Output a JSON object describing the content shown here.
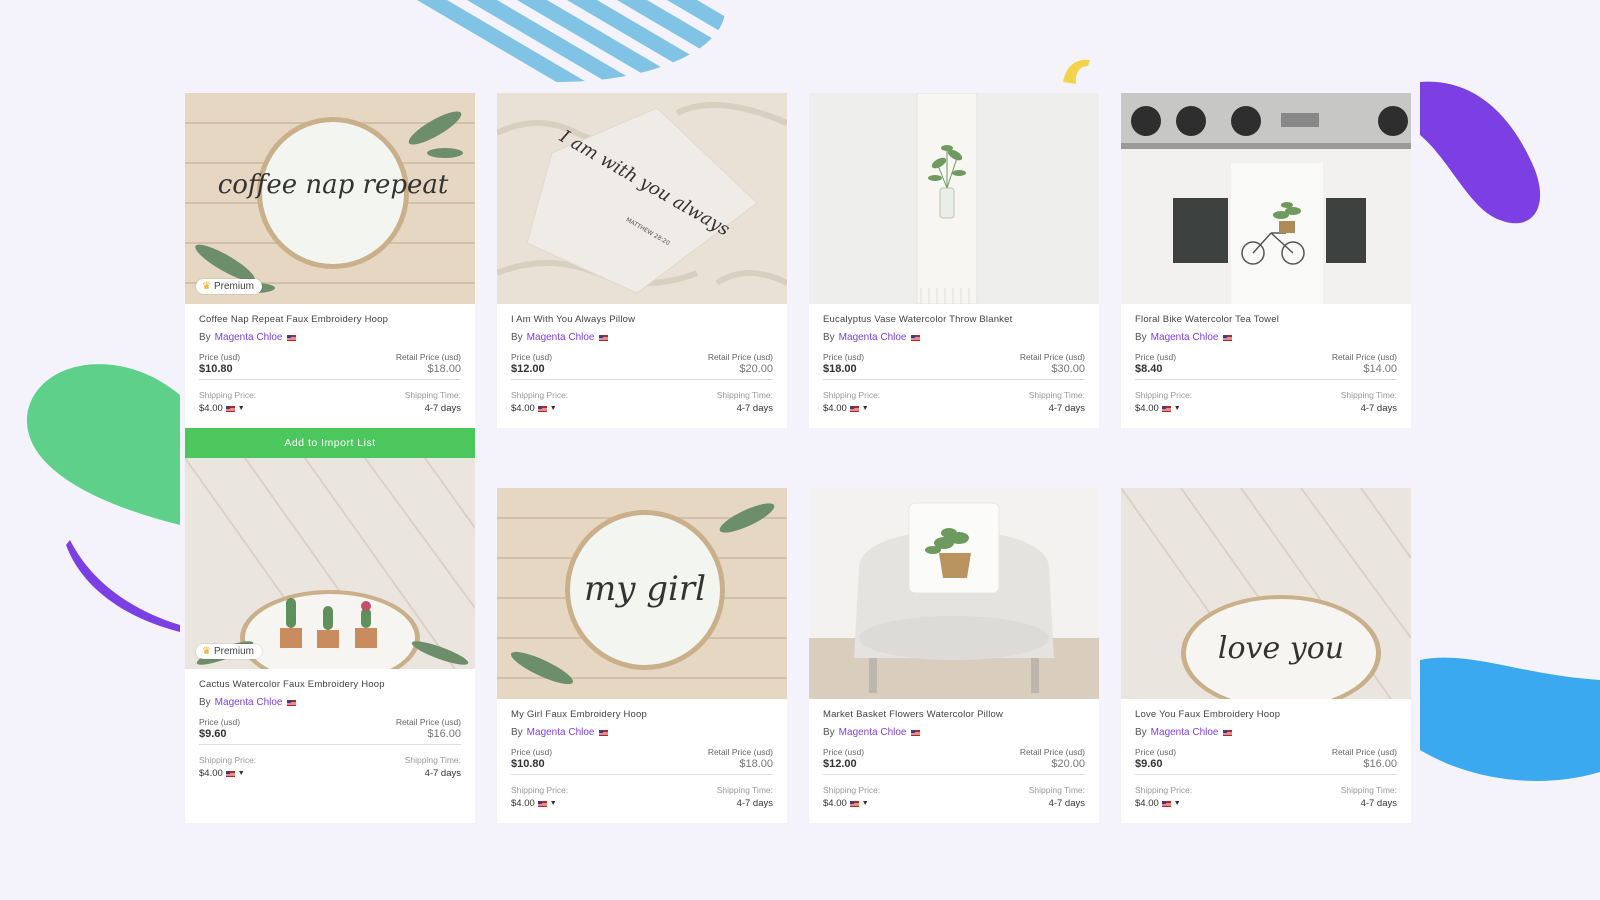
{
  "products": [
    {
      "title": "Coffee Nap Repeat Faux Embroidery Hoop",
      "by": "By",
      "author": "Magenta Chloe",
      "premium": "Premium",
      "price_label": "Price (usd)",
      "price": "$10.80",
      "retail_label": "Retail Price (usd)",
      "retail": "$18.00",
      "ship_label": "Shipping Price:",
      "ship_price": "$4.00",
      "time_label": "Shipping Time:",
      "ship_time": "4-7 days",
      "image": "embroidery-hoop-coffee-nap-repeat"
    },
    {
      "title": "I Am With You Always Pillow",
      "by": "By",
      "author": "Magenta Chloe",
      "premium": "",
      "price_label": "Price (usd)",
      "price": "$12.00",
      "retail_label": "Retail Price (usd)",
      "retail": "$20.00",
      "ship_label": "Shipping Price:",
      "ship_price": "$4.00",
      "time_label": "Shipping Time:",
      "ship_time": "4-7 days",
      "image": "pillow-calligraphy"
    },
    {
      "title": "Eucalyptus Vase Watercolor Throw Blanket",
      "by": "By",
      "author": "Magenta Chloe",
      "premium": "",
      "price_label": "Price (usd)",
      "price": "$18.00",
      "retail_label": "Retail Price (usd)",
      "retail": "$30.00",
      "ship_label": "Shipping Price:",
      "ship_price": "$4.00",
      "time_label": "Shipping Time:",
      "ship_time": "4-7 days",
      "image": "throw-blanket-eucalyptus"
    },
    {
      "title": "Floral Bike Watercolor Tea Towel",
      "by": "By",
      "author": "Magenta Chloe",
      "premium": "",
      "price_label": "Price (usd)",
      "price": "$8.40",
      "retail_label": "Retail Price (usd)",
      "retail": "$14.00",
      "ship_label": "Shipping Price:",
      "ship_price": "$4.00",
      "time_label": "Shipping Time:",
      "ship_time": "4-7 days",
      "image": "tea-towel-bike"
    },
    {
      "title": "Cactus Watercolor Faux Embroidery Hoop",
      "by": "By",
      "author": "Magenta Chloe",
      "premium": "Premium",
      "price_label": "Price (usd)",
      "price": "$9.60",
      "retail_label": "Retail Price (usd)",
      "retail": "$16.00",
      "ship_label": "Shipping Price:",
      "ship_price": "$4.00",
      "time_label": "Shipping Time:",
      "ship_time": "4-7 days",
      "image": "embroidery-hoop-cactus"
    },
    {
      "title": "My Girl Faux Embroidery Hoop",
      "by": "By",
      "author": "Magenta Chloe",
      "premium": "",
      "price_label": "Price (usd)",
      "price": "$10.80",
      "retail_label": "Retail Price (usd)",
      "retail": "$18.00",
      "ship_label": "Shipping Price:",
      "ship_price": "$4.00",
      "time_label": "Shipping Time:",
      "ship_time": "4-7 days",
      "image": "embroidery-hoop-my-girl"
    },
    {
      "title": "Market Basket Flowers Watercolor Pillow",
      "by": "By",
      "author": "Magenta Chloe",
      "premium": "",
      "price_label": "Price (usd)",
      "price": "$12.00",
      "retail_label": "Retail Price (usd)",
      "retail": "$20.00",
      "ship_label": "Shipping Price:",
      "ship_price": "$4.00",
      "time_label": "Shipping Time:",
      "ship_time": "4-7 days",
      "image": "pillow-basket-chair"
    },
    {
      "title": "Love You Faux Embroidery Hoop",
      "by": "By",
      "author": "Magenta Chloe",
      "premium": "",
      "price_label": "Price (usd)",
      "price": "$9.60",
      "retail_label": "Retail Price (usd)",
      "retail": "$16.00",
      "ship_label": "Shipping Price:",
      "ship_price": "$4.00",
      "time_label": "Shipping Time:",
      "ship_time": "4-7 days",
      "image": "embroidery-hoop-love-you"
    }
  ],
  "add_button_label": "Add to Import List",
  "image_text": {
    "hoop1": "coffee nap repeat",
    "pillow": "I am with you always",
    "pillow_verse": "MATTHEW 28:20",
    "hoop_mygirl": "my girl",
    "hoop_love": "love you"
  },
  "colors": {
    "accent": "#7b3fe4",
    "button": "#4bc75d",
    "background": "#f4f3fb",
    "blob_green": "#5fd08a",
    "blob_purple": "#7b3fe4",
    "blob_blue": "#3aa9f0",
    "stripes": "#7fc3e6",
    "yellow": "#f3d34a"
  }
}
